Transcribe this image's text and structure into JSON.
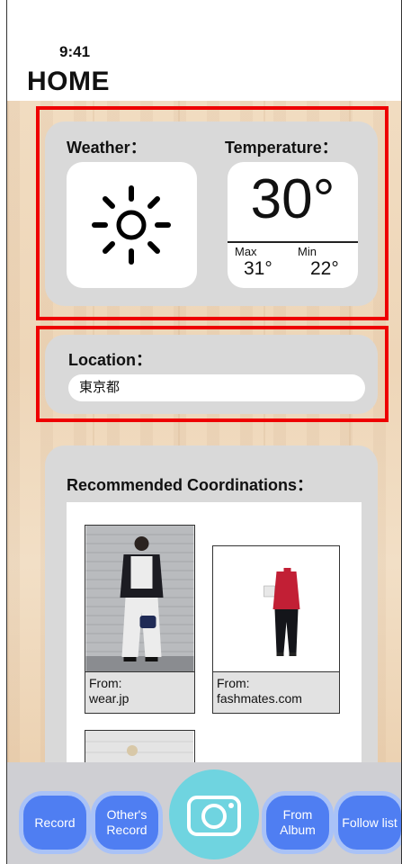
{
  "status_bar": {
    "time": "9:41"
  },
  "header": {
    "title": "HOME"
  },
  "weather": {
    "label": "Weather：",
    "condition_icon": "sun-icon",
    "temperature_label": "Temperature：",
    "current_temp": "30°",
    "max_label": "Max",
    "max_value": "31°",
    "min_label": "Min",
    "min_value": "22°"
  },
  "location": {
    "label": "Location：",
    "value": "東京都"
  },
  "coordinations": {
    "label": "Recommended Coordinations：",
    "items": [
      {
        "caption_from": "From:",
        "source": "wear.jp"
      },
      {
        "caption_from": "From:",
        "source": "fashmates.com"
      }
    ]
  },
  "bottom_nav": {
    "record": "Record",
    "others_record": "Other's Record",
    "camera_icon": "camera-icon",
    "from_album": "From Album",
    "follow_list": "Follow list"
  },
  "colors": {
    "accent_red": "#ee0000",
    "nav_button": "#4f7ef2",
    "camera_button": "#6fd4e0"
  }
}
